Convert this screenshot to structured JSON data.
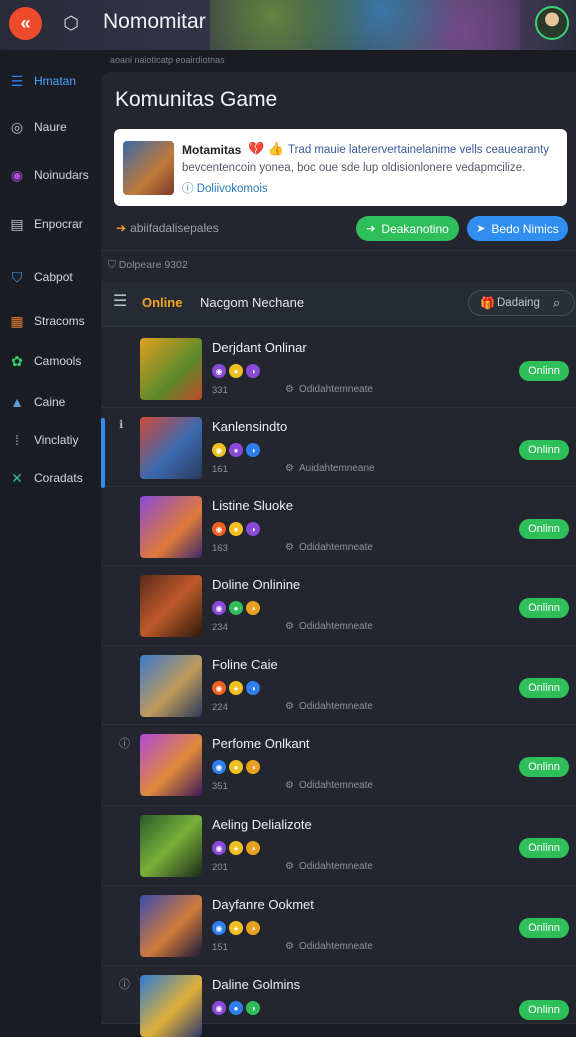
{
  "header": {
    "logo_icon": "double-chevron-left-icon",
    "app_icon": "hexagon-icon",
    "title": "Nomomitar",
    "colors": {
      "logo_bg": "#ee4b2b",
      "avatar_ring": "#3ad07a"
    }
  },
  "sidebar": {
    "items": [
      {
        "label": "Hmatan",
        "icon": "menu-icon",
        "active": true
      },
      {
        "label": "Naure",
        "icon": "globe-icon"
      },
      {
        "label": "Noinudars",
        "icon": "eye-icon"
      },
      {
        "label": "Enpocrar",
        "icon": "bag-icon"
      },
      {
        "label": "Cabpot",
        "icon": "shield-icon"
      },
      {
        "label": "Stracoms",
        "icon": "image-icon"
      },
      {
        "label": "Camools",
        "icon": "palette-icon"
      },
      {
        "label": "Caine",
        "icon": "landscape-icon"
      },
      {
        "label": "Vinclatiy",
        "icon": "grid-icon"
      },
      {
        "label": "Coradats",
        "icon": "x-icon"
      }
    ]
  },
  "subtitle_strip": "aoani naioticatp eoairdiotnas",
  "main": {
    "title": "Komunitas Game",
    "card": {
      "name": "Motamitas",
      "emoji": "💔 👍",
      "desc1": "Trad mauie laterervertainelanime vells ceauearanty",
      "desc2": "bevcentencoin yonea, boc oue sde lup oldisionlonere vedapmcilize.",
      "link_icon": "info-circle-icon",
      "link": "Doliivokomois"
    },
    "info_row": "abiifadalisepales",
    "info_icon": "arrow-right-icon",
    "button_green": "Deakanotino",
    "button_green_icon": "arrow-right-icon",
    "button_blue": "Bedo Nimics",
    "button_blue_icon": "send-icon",
    "meta": "Dolpeare 9302",
    "meta_icon": "shield-small-icon",
    "tabs": {
      "online": "Online",
      "other": "Nacgom Nechane"
    },
    "search": {
      "label": "Dadaing",
      "icon": "gift-icon",
      "search_icon": "search-icon"
    },
    "online_label": "Onlinn",
    "rows": [
      {
        "title": "Derjdant Onlinar",
        "count": "331",
        "status": "Odidahtemneate",
        "badges": [
          "#8a4ad8",
          "#f0c020",
          "#8a4ad8"
        ],
        "selected": false,
        "side_icon": ""
      },
      {
        "title": "Kanlensindto",
        "count": "161",
        "status": "Auidahtemneane",
        "badges": [
          "#f0c020",
          "#8a4ad8",
          "#2f7ef0"
        ],
        "selected": true,
        "side_icon": "ℹ"
      },
      {
        "title": "Listine Sluoke",
        "count": "163",
        "status": "Odidahtemneate",
        "badges": [
          "#f06020",
          "#f0c020",
          "#8a4ad8"
        ],
        "selected": false,
        "side_icon": ""
      },
      {
        "title": "Doline Onlinine",
        "count": "234",
        "status": "Odidahtemneate",
        "badges": [
          "#8a4ad8",
          "#2fbf5a",
          "#e8a020"
        ],
        "selected": false,
        "side_icon": ""
      },
      {
        "title": "Foline Caie",
        "count": "224",
        "status": "Odidahtemneate",
        "badges": [
          "#f06020",
          "#f0c020",
          "#2f7ef0"
        ],
        "selected": false,
        "side_icon": ""
      },
      {
        "title": "Perfome Onlkant",
        "count": "351",
        "status": "Odidahtemneate",
        "badges": [
          "#2f7ef0",
          "#f0c020",
          "#e8a020"
        ],
        "selected": false,
        "side_icon": "ⓘ"
      },
      {
        "title": "Aeling Delializote",
        "count": "201",
        "status": "Odidahtemneate",
        "badges": [
          "#8a4ad8",
          "#f0c020",
          "#e8a020"
        ],
        "selected": false,
        "side_icon": ""
      },
      {
        "title": "Dayfanre Ookmet",
        "count": "151",
        "status": "Odidahtemneate",
        "badges": [
          "#2f7ef0",
          "#f0c020",
          "#e8a020"
        ],
        "selected": false,
        "side_icon": ""
      },
      {
        "title": "Daline Golmins",
        "count": "",
        "status": "",
        "badges": [
          "#8a4ad8",
          "#2f7ef0",
          "#2fbf5a"
        ],
        "selected": false,
        "side_icon": "ⓘ"
      }
    ]
  }
}
